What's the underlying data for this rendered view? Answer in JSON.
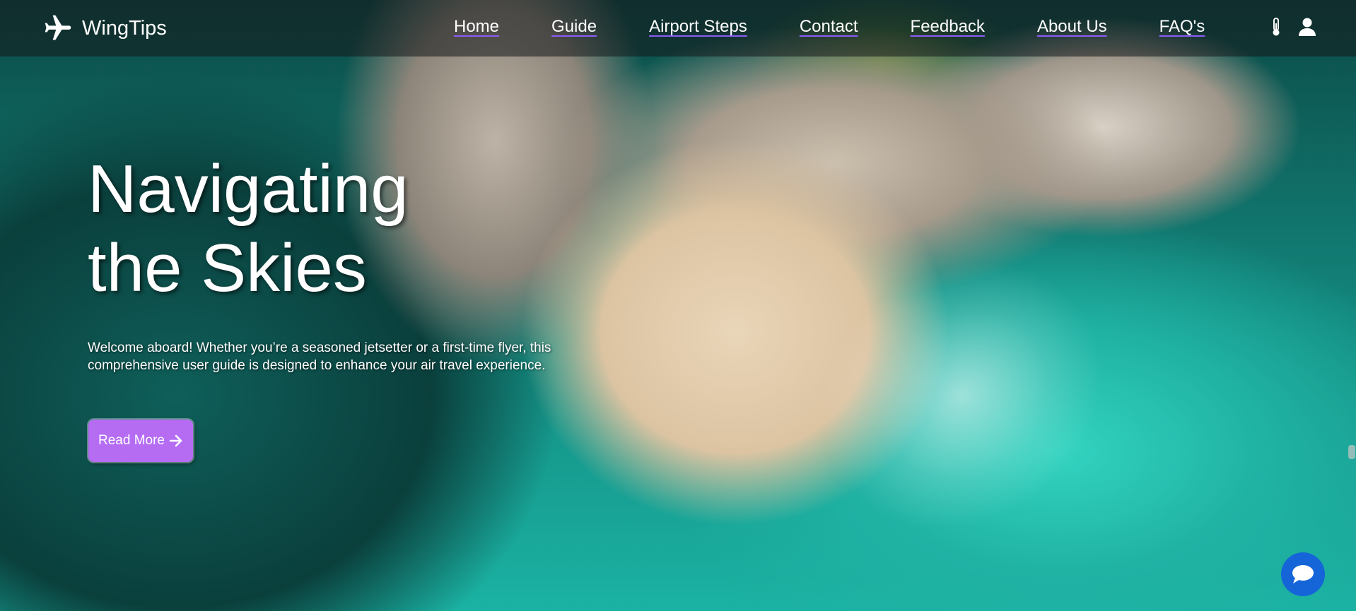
{
  "brand": {
    "name": "WingTips",
    "icon": "airplane-icon"
  },
  "nav": {
    "links": [
      "Home",
      "Guide",
      "Airport Steps",
      "Contact",
      "Feedback",
      "About Us",
      "FAQ's"
    ],
    "icons": [
      "thermometer-icon",
      "user-icon"
    ],
    "underline_color": "#8b5cf6"
  },
  "hero": {
    "title_line1": "Navigating",
    "title_line2": "the Skies",
    "description": "Welcome aboard! Whether you’re a seasoned jetsetter or a first-time flyer, this comprehensive user guide is designed to enhance your air travel experience.",
    "button_label": "Read More",
    "button_icon": "arrow-right-icon",
    "button_color": "#b56cf3"
  },
  "chat": {
    "icon": "chat-bubble-icon",
    "color": "#1565d8"
  }
}
